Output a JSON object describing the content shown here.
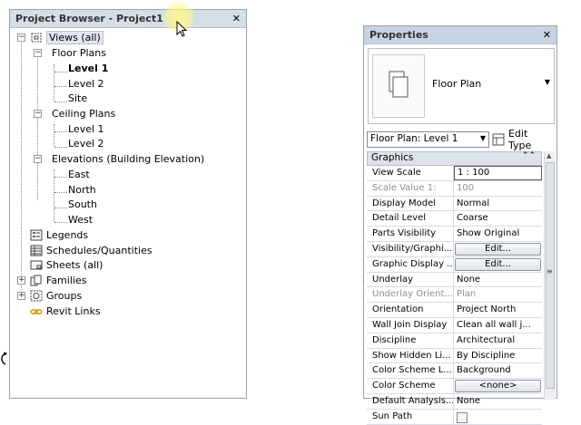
{
  "project_browser": {
    "title": "Project Browser - Project1",
    "close": "✕",
    "tree": {
      "views": "Views (all)",
      "floor_plans": "Floor Plans",
      "floor_plans_items": [
        "Level 1",
        "Level 2",
        "Site"
      ],
      "ceiling_plans": "Ceiling Plans",
      "ceiling_plans_items": [
        "Level 1",
        "Level 2"
      ],
      "elevations": "Elevations (Building Elevation)",
      "elevations_items": [
        "East",
        "North",
        "South",
        "West"
      ],
      "legends": "Legends",
      "schedules": "Schedules/Quantities",
      "sheets": "Sheets (all)",
      "families": "Families",
      "groups": "Groups",
      "revit_links": "Revit Links"
    }
  },
  "properties": {
    "title": "Properties",
    "close": "✕",
    "type_name": "Floor Plan",
    "instance_selector": "Floor Plan: Level 1",
    "edit_type": "Edit Type",
    "group_title": "Graphics",
    "rows": [
      {
        "name": "View Scale",
        "value": "1 : 100"
      },
      {
        "name": "Scale Value    1:",
        "value": "100"
      },
      {
        "name": "Display Model",
        "value": "Normal"
      },
      {
        "name": "Detail Level",
        "value": "Coarse"
      },
      {
        "name": "Parts Visibility",
        "value": "Show Original"
      },
      {
        "name": "Visibility/Graphi...",
        "value": "Edit..."
      },
      {
        "name": "Graphic Display ...",
        "value": "Edit..."
      },
      {
        "name": "Underlay",
        "value": "None"
      },
      {
        "name": "Underlay Orient...",
        "value": "Plan"
      },
      {
        "name": "Orientation",
        "value": "Project North"
      },
      {
        "name": "Wall Join Display",
        "value": "Clean all wall j..."
      },
      {
        "name": "Discipline",
        "value": "Architectural"
      },
      {
        "name": "Show Hidden Li...",
        "value": "By Discipline"
      },
      {
        "name": "Color Scheme L...",
        "value": "Background"
      },
      {
        "name": "Color Scheme",
        "value": "<none>"
      },
      {
        "name": "Default Analysis...",
        "value": "None"
      },
      {
        "name": "Sun Path",
        "value": ""
      }
    ]
  },
  "colors": {
    "titlebar": "#d5dde7",
    "highlight": "#fff88c",
    "border": "#9aa3ad"
  }
}
